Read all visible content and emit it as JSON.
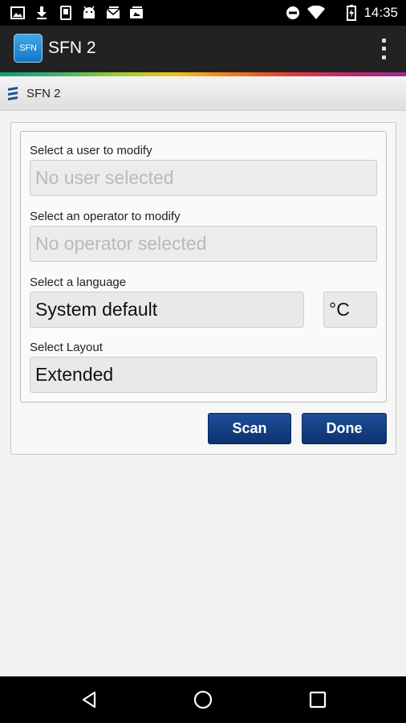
{
  "status_bar": {
    "time": "14:35",
    "left_icons": [
      "image-icon",
      "download-icon",
      "phone-icon",
      "android-icon",
      "mail-icon",
      "sd-card-icon"
    ],
    "right_icons": [
      "do-not-disturb-icon",
      "wifi-icon",
      "battery-icon"
    ]
  },
  "action_bar": {
    "app_icon_text": "SFN",
    "title": "SFN 2"
  },
  "sub_header": {
    "title": "SFN 2"
  },
  "form": {
    "user": {
      "label": "Select a user to modify",
      "value": "No user selected"
    },
    "operator": {
      "label": "Select an operator to modify",
      "value": "No operator selected"
    },
    "language": {
      "label": "Select a language",
      "value": "System default"
    },
    "unit": {
      "value": "°C"
    },
    "layout": {
      "label": "Select Layout",
      "value": "Extended"
    }
  },
  "buttons": {
    "scan": "Scan",
    "done": "Done"
  },
  "colors": {
    "button_blue": "#0d326e",
    "action_bar": "#222222"
  }
}
